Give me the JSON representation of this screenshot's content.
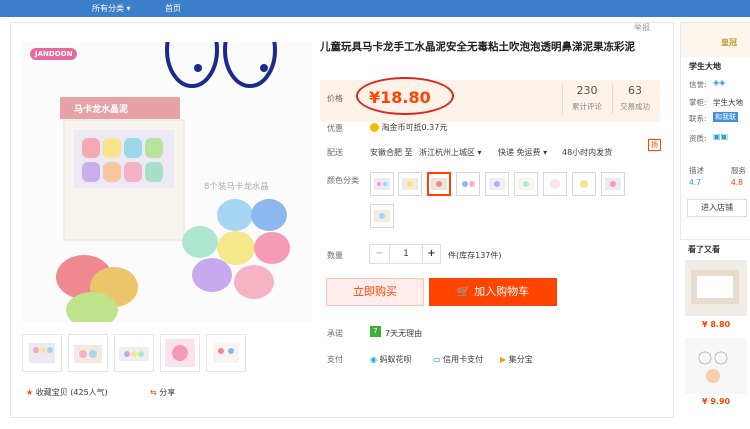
{
  "topnav": {
    "all_categories": "所有分类 ▾",
    "home": "首页"
  },
  "report": "举报",
  "product": {
    "title": "儿童玩具马卡龙手工水晶泥安全无毒粘土吹泡泡透明鼻涕泥果冻彩泥",
    "banner_text": "马卡龙水晶泥",
    "box_caption": "8个装马卡龙水晶",
    "brand": "JANDOON"
  },
  "price": {
    "label": "价格",
    "currency": "¥",
    "value": "18.80"
  },
  "stats": {
    "reviews_count": "230",
    "reviews_label": "累计评论",
    "sales_count": "63",
    "sales_label": "交易成功"
  },
  "promo": {
    "label": "优惠",
    "text": "淘金币可抵0.37元"
  },
  "shipping": {
    "label": "配送",
    "origin": "安徽合肥 至",
    "destination": "浙江杭州上城区 ▾",
    "method": "快递 免运费 ▾",
    "time": "48小时内发货"
  },
  "color": {
    "label": "颜色分类"
  },
  "quantity": {
    "label": "数量",
    "minus": "−",
    "value": "1",
    "plus": "+",
    "stock": "件(库存137件)"
  },
  "buttons": {
    "buy_now": "立即购买",
    "add_to_cart": "加入购物车"
  },
  "promise": {
    "label": "承诺",
    "badge": "7",
    "text": "7天无理由"
  },
  "payment": {
    "label": "支付",
    "methods": [
      "蚂蚁花呗",
      "信用卡支付",
      "集分宝"
    ]
  },
  "actions": {
    "favorite": "收藏宝贝",
    "popularity": "(425人气)",
    "share": "分享"
  },
  "tab_right": "扬",
  "shop": {
    "banner": "皇冠",
    "name": "学生大地",
    "reputation_label": "信誉:",
    "seller_label": "掌柜:",
    "seller_name": "学生大地",
    "contact_label": "联系:",
    "contact_text": "和我联",
    "qual_label": "资质:",
    "desc_label": "描述",
    "desc_score": "4.7",
    "service_label": "服务",
    "service_score": "4.8",
    "enter_shop": "进入店铺"
  },
  "recommend": {
    "title": "看了又看",
    "items": [
      {
        "price": "¥ 8.80"
      },
      {
        "price": "¥ 9.90"
      }
    ]
  },
  "colors": {
    "accent": "#ff4400",
    "nav": "#3b7ec9"
  }
}
